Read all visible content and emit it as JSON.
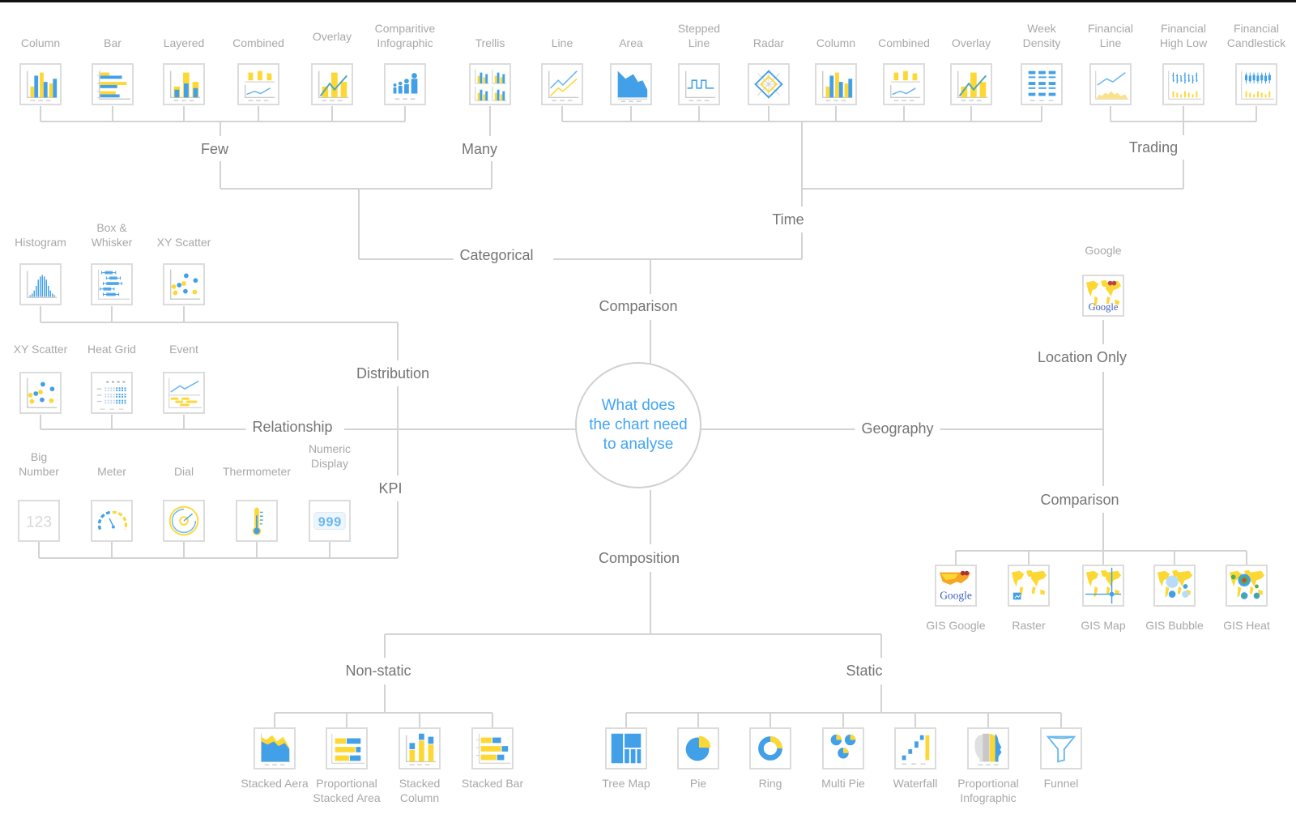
{
  "center_question": "What does\nthe chart need\nto  analyse",
  "colors": {
    "blue": "#42a0e8",
    "yellow": "#fdd835",
    "line": "#d3d3d3",
    "label": "#a8a8a8",
    "category": "#757575",
    "center_text": "#42a5f5"
  },
  "categories": {
    "comparison": "Comparison",
    "categorical": "Categorical",
    "few": "Few",
    "many": "Many",
    "time": "Time",
    "trading": "Trading",
    "distribution": "Distribution",
    "relationship": "Relationship",
    "kpi": "KPI",
    "geography": "Geography",
    "location_only": "Location Only",
    "geo_comparison": "Comparison",
    "composition": "Composition",
    "non_static": "Non-static",
    "static": "Static"
  },
  "charts": {
    "few": [
      {
        "label": "Column",
        "icon": "column-chart-icon"
      },
      {
        "label": "Bar",
        "icon": "bar-chart-icon"
      },
      {
        "label": "Layered",
        "icon": "layered-chart-icon"
      },
      {
        "label": "Combined",
        "icon": "combined-chart-icon"
      },
      {
        "label": "Overlay",
        "icon": "overlay-chart-icon"
      },
      {
        "label": "Comparitive\nInfographic",
        "icon": "people-infographic-icon"
      }
    ],
    "many": [
      {
        "label": "Trellis",
        "icon": "trellis-chart-icon"
      }
    ],
    "time": [
      {
        "label": "Line",
        "icon": "line-chart-icon"
      },
      {
        "label": "Area",
        "icon": "area-chart-icon"
      },
      {
        "label": "Stepped\nLine",
        "icon": "stepped-line-icon"
      },
      {
        "label": "Radar",
        "icon": "radar-chart-icon"
      },
      {
        "label": "Column",
        "icon": "column-chart-icon"
      },
      {
        "label": "Combined",
        "icon": "combined-chart-icon"
      },
      {
        "label": "Overlay",
        "icon": "overlay-chart-icon"
      },
      {
        "label": "Week\nDensity",
        "icon": "week-density-icon"
      }
    ],
    "trading": [
      {
        "label": "Financial\nLine",
        "icon": "financial-line-icon"
      },
      {
        "label": "Financial\nHigh Low",
        "icon": "financial-high-low-icon"
      },
      {
        "label": "Financial\nCandlestick",
        "icon": "candlestick-icon"
      }
    ],
    "distribution": [
      {
        "label": "Histogram",
        "icon": "histogram-icon"
      },
      {
        "label": "Box &\nWhisker",
        "icon": "box-whisker-icon"
      },
      {
        "label": "XY Scatter",
        "icon": "scatter-icon"
      }
    ],
    "relationship": [
      {
        "label": "XY Scatter",
        "icon": "scatter-icon"
      },
      {
        "label": "Heat Grid",
        "icon": "heat-grid-icon"
      },
      {
        "label": "Event",
        "icon": "event-chart-icon"
      }
    ],
    "kpi": [
      {
        "label": "Big\nNumber",
        "icon": "big-number-icon",
        "text": "123"
      },
      {
        "label": "Meter",
        "icon": "meter-icon"
      },
      {
        "label": "Dial",
        "icon": "dial-icon"
      },
      {
        "label": "Thermometer",
        "icon": "thermometer-icon"
      },
      {
        "label": "Numeric\nDisplay",
        "icon": "numeric-display-icon",
        "text": "999"
      }
    ],
    "location_only": [
      {
        "label": "Google",
        "icon": "google-map-icon",
        "brand": "Google"
      }
    ],
    "geo_comparison": [
      {
        "label": "GIS Google",
        "icon": "gis-google-icon",
        "brand": "Google"
      },
      {
        "label": "Raster",
        "icon": "raster-map-icon"
      },
      {
        "label": "GIS Map",
        "icon": "gis-map-icon"
      },
      {
        "label": "GIS Bubble",
        "icon": "gis-bubble-icon"
      },
      {
        "label": "GIS Heat",
        "icon": "gis-heat-icon"
      }
    ],
    "non_static": [
      {
        "label": "Stacked Aera",
        "icon": "stacked-area-icon"
      },
      {
        "label": "Proportional\nStacked Area",
        "icon": "proportional-stacked-icon"
      },
      {
        "label": "Stacked\nColumn",
        "icon": "stacked-column-icon"
      },
      {
        "label": "Stacked Bar",
        "icon": "stacked-bar-icon"
      }
    ],
    "static": [
      {
        "label": "Tree Map",
        "icon": "tree-map-icon"
      },
      {
        "label": "Pie",
        "icon": "pie-chart-icon"
      },
      {
        "label": "Ring",
        "icon": "ring-chart-icon"
      },
      {
        "label": "Multi Pie",
        "icon": "multi-pie-icon"
      },
      {
        "label": "Waterfall",
        "icon": "waterfall-icon"
      },
      {
        "label": "Proportional\nInfographic",
        "icon": "head-infographic-icon"
      },
      {
        "label": "Funnel",
        "icon": "funnel-icon"
      }
    ]
  }
}
